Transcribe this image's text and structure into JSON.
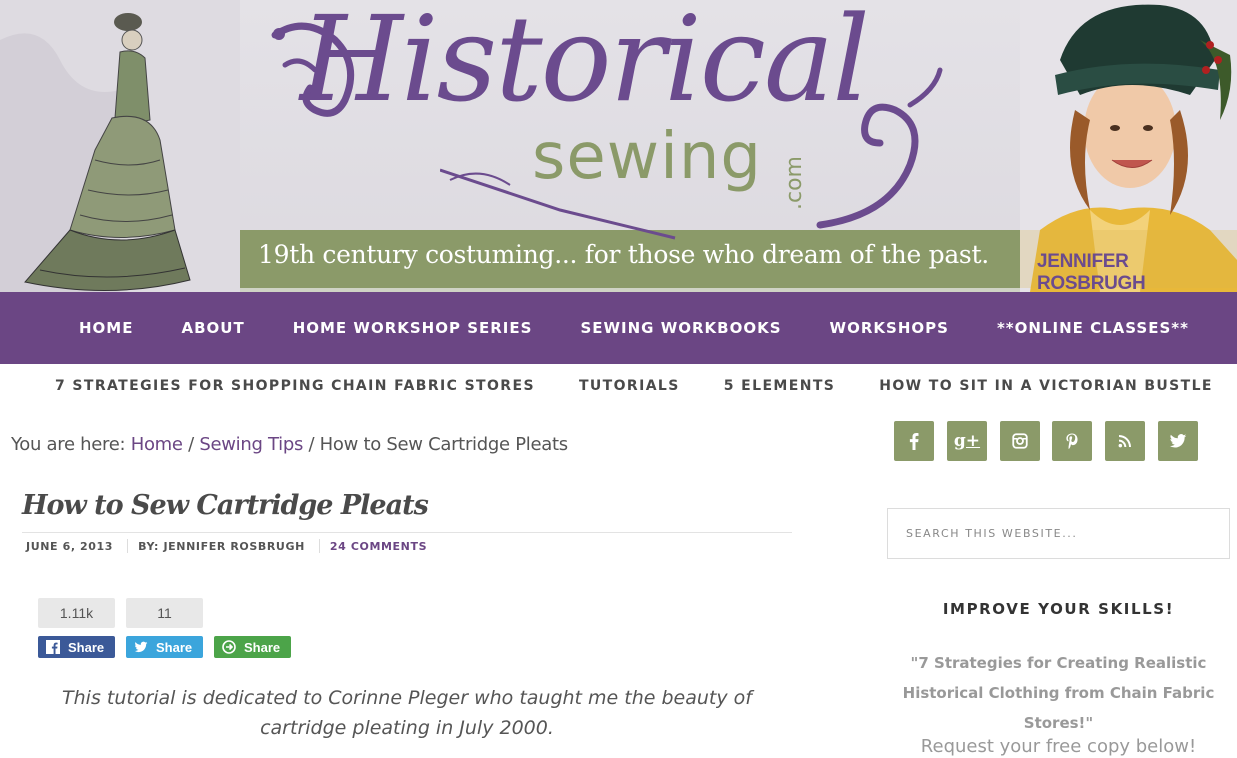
{
  "header": {
    "logo_main": "Historical",
    "logo_sub": "sewing",
    "logo_suffix": ".com",
    "tagline": "19th century costuming... for those who dream of the past.",
    "author": "JENNIFER ROSBRUGH",
    "colors": {
      "purple": "#6b4684",
      "green": "#8b9a69"
    }
  },
  "primary_nav": [
    "HOME",
    "ABOUT",
    "HOME WORKSHOP SERIES",
    "SEWING WORKBOOKS",
    "WORKSHOPS",
    "**ONLINE CLASSES**"
  ],
  "secondary_nav": [
    "7 STRATEGIES FOR SHOPPING CHAIN FABRIC STORES",
    "TUTORIALS",
    "5 ELEMENTS",
    "HOW TO SIT IN A VICTORIAN BUSTLE"
  ],
  "breadcrumb": {
    "prefix": "You are here:",
    "home": "Home",
    "sep": "/",
    "category": "Sewing Tips",
    "current": "How to Sew Cartridge Pleats"
  },
  "post": {
    "title": "How to Sew Cartridge Pleats",
    "date": "JUNE 6, 2013",
    "author": "BY: JENNIFER ROSBRUGH",
    "comments": "24 COMMENTS",
    "dedication": "This tutorial is dedicated to Corinne Pleger who taught me the beauty of cartridge pleating in July 2000."
  },
  "share": {
    "facebook_count": "1.11k",
    "twitter_count": "11",
    "facebook_label": "Share",
    "twitter_label": "Share",
    "more_label": "Share",
    "colors": {
      "facebook": "#3b5998",
      "twitter": "#3ba5dc",
      "more": "#4ca449"
    }
  },
  "sidebar": {
    "social_icons": [
      "facebook-icon",
      "google-plus-icon",
      "instagram-icon",
      "pinterest-icon",
      "rss-icon",
      "twitter-icon"
    ],
    "search_placeholder": "SEARCH THIS WEBSITE...",
    "widget_title": "IMPROVE YOUR SKILLS!",
    "widget_text": "\"7 Strategies for Creating Realistic Historical Clothing from Chain Fabric Stores!\"",
    "widget_cta": "Request your free copy below!"
  }
}
